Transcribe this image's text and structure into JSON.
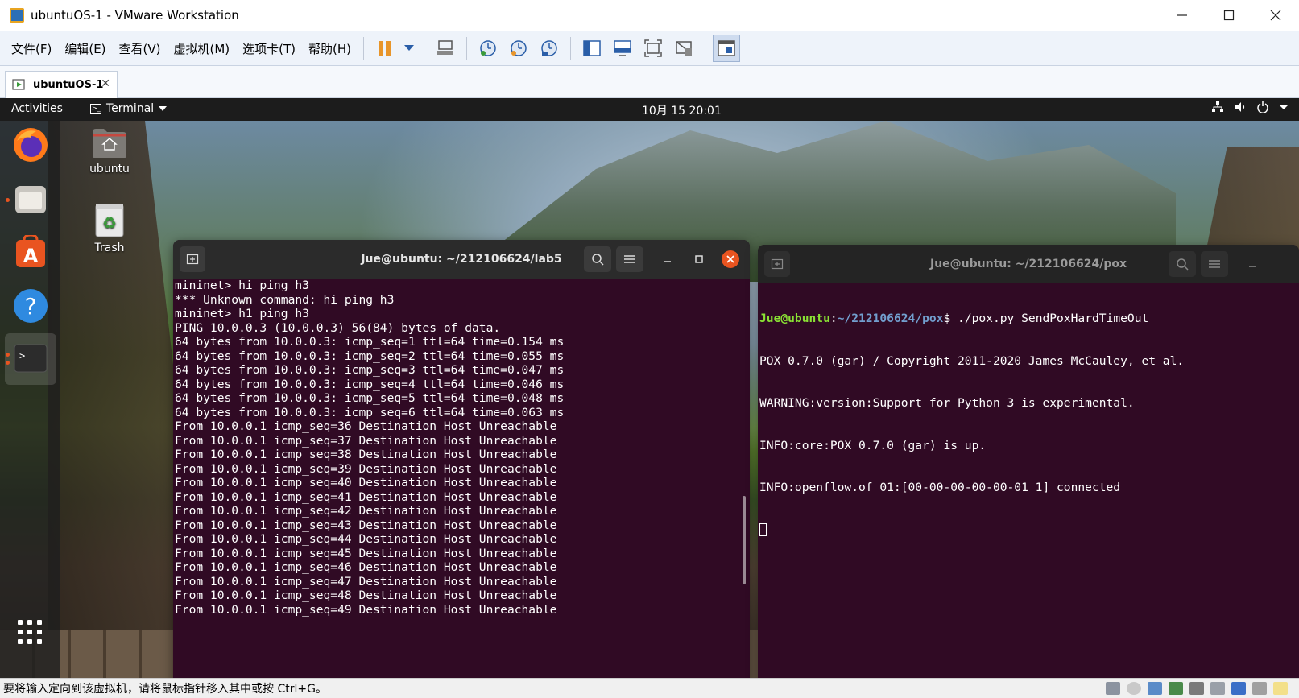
{
  "window": {
    "title": "ubuntuOS-1 - VMware Workstation"
  },
  "menubar": {
    "items": [
      "文件(F)",
      "编辑(E)",
      "查看(V)",
      "虚拟机(M)",
      "选项卡(T)",
      "帮助(H)"
    ]
  },
  "tabs": [
    {
      "label": "ubuntuOS-1",
      "close": "✕"
    }
  ],
  "ubuntu_topbar": {
    "activities": "Activities",
    "app_menu": "Terminal",
    "clock": "10月 15  20:01"
  },
  "desktop_icons": {
    "home": "ubuntu",
    "trash": "Trash"
  },
  "terminal_left": {
    "title": "Jue@ubuntu: ~/212106624/lab5",
    "lines": [
      "mininet> hi ping h3",
      "*** Unknown command: hi ping h3",
      "mininet> h1 ping h3",
      "PING 10.0.0.3 (10.0.0.3) 56(84) bytes of data.",
      "64 bytes from 10.0.0.3: icmp_seq=1 ttl=64 time=0.154 ms",
      "64 bytes from 10.0.0.3: icmp_seq=2 ttl=64 time=0.055 ms",
      "64 bytes from 10.0.0.3: icmp_seq=3 ttl=64 time=0.047 ms",
      "64 bytes from 10.0.0.3: icmp_seq=4 ttl=64 time=0.046 ms",
      "64 bytes from 10.0.0.3: icmp_seq=5 ttl=64 time=0.048 ms",
      "64 bytes from 10.0.0.3: icmp_seq=6 ttl=64 time=0.063 ms",
      "From 10.0.0.1 icmp_seq=36 Destination Host Unreachable",
      "From 10.0.0.1 icmp_seq=37 Destination Host Unreachable",
      "From 10.0.0.1 icmp_seq=38 Destination Host Unreachable",
      "From 10.0.0.1 icmp_seq=39 Destination Host Unreachable",
      "From 10.0.0.1 icmp_seq=40 Destination Host Unreachable",
      "From 10.0.0.1 icmp_seq=41 Destination Host Unreachable",
      "From 10.0.0.1 icmp_seq=42 Destination Host Unreachable",
      "From 10.0.0.1 icmp_seq=43 Destination Host Unreachable",
      "From 10.0.0.1 icmp_seq=44 Destination Host Unreachable",
      "From 10.0.0.1 icmp_seq=45 Destination Host Unreachable",
      "From 10.0.0.1 icmp_seq=46 Destination Host Unreachable",
      "From 10.0.0.1 icmp_seq=47 Destination Host Unreachable",
      "From 10.0.0.1 icmp_seq=48 Destination Host Unreachable",
      "From 10.0.0.1 icmp_seq=49 Destination Host Unreachable"
    ]
  },
  "terminal_right": {
    "title": "Jue@ubuntu: ~/212106624/pox",
    "prompt_user": "Jue@ubuntu",
    "prompt_sep": ":",
    "prompt_path": "~/212106624/pox",
    "prompt_cmd": "$ ./pox.py SendPoxHardTimeOut",
    "lines": [
      "POX 0.7.0 (gar) / Copyright 2011-2020 James McCauley, et al.",
      "WARNING:version:Support for Python 3 is experimental.",
      "INFO:core:POX 0.7.0 (gar) is up.",
      "INFO:openflow.of_01:[00-00-00-00-00-01 1] connected"
    ]
  },
  "statusbar": {
    "text": "要将输入定向到该虚拟机，请将鼠标指针移入其中或按 Ctrl+G。"
  },
  "colors": {
    "terminal_bg": "#300a24",
    "ubuntu_orange": "#e95420",
    "prompt_user": "#8ae234",
    "prompt_path": "#729fcf"
  }
}
